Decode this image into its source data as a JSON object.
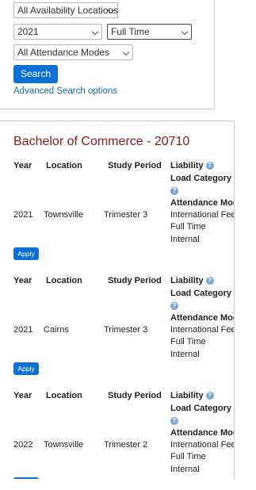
{
  "search": {
    "location_filter": "All Availability Locations",
    "year_filter": "2021",
    "load_filter": "Full Time",
    "attendance_filter": "All Attendance Modes",
    "search_label": "Search",
    "advanced_link": "Advanced Search options"
  },
  "results": {
    "course_title": "Bachelor of Commerce - 20710",
    "headers": {
      "year": "Year",
      "location": "Location",
      "study_period": "Study Period",
      "liability": "Liability",
      "load_category": "Load Category",
      "attendance_mode": "Attendance Mode"
    },
    "apply_label": "Apply",
    "offerings": [
      {
        "year": "2021",
        "location": "Townsville",
        "study_period": "Trimester 3",
        "liability": "International Fee",
        "load": "Full Time",
        "attendance": "Internal"
      },
      {
        "year": "2021",
        "location": "Cairns",
        "study_period": "Trimester 3",
        "liability": "International Fee",
        "load": "Full Time",
        "attendance": "Internal"
      },
      {
        "year": "2022",
        "location": "Townsville",
        "study_period": "Trimester 2",
        "liability": "International Fee",
        "load": "Full Time",
        "attendance": "Internal"
      }
    ]
  }
}
